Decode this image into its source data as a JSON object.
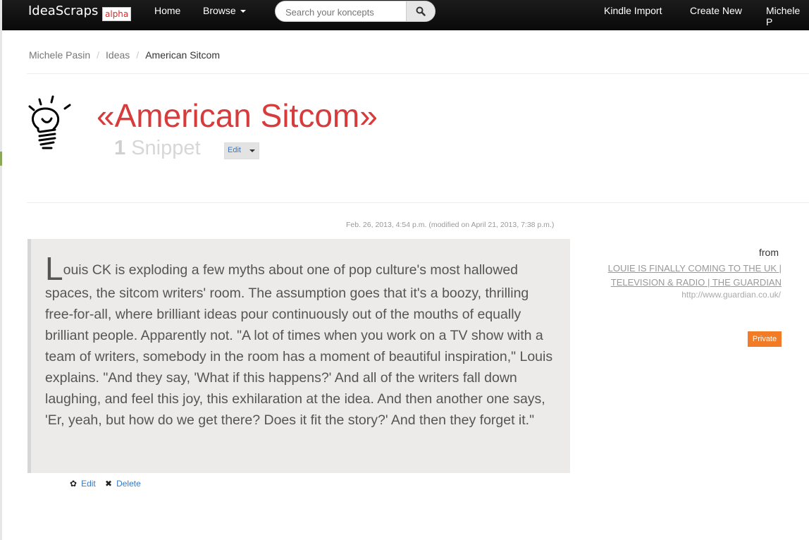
{
  "navbar": {
    "brand": "IdeaScraps",
    "brand_tag": "alpha",
    "links": {
      "home": "Home",
      "browse": "Browse",
      "kindle": "Kindle Import",
      "create": "Create New",
      "user": "Michele P"
    },
    "search": {
      "placeholder": "Search your koncepts",
      "value": ""
    }
  },
  "breadcrumb": [
    "Michele Pasin",
    "Ideas",
    "American Sitcom"
  ],
  "page": {
    "title": "«American Sitcom»",
    "snippet_count": "1",
    "snippet_label": "Snippet",
    "edit_label": "Edit"
  },
  "snippet": {
    "date": "Feb. 26, 2013, 4:54 p.m. (modified on April 21, 2013, 7:38 p.m.)",
    "drop_cap": "L",
    "text": "ouis CK is exploding a few myths about one of pop culture's most hallowed spaces, the sitcom writers' room. The assumption goes that it's a boozy, thrilling free-for-all, where brilliant ideas pour continuously out of the mouths of equally brilliant people. Apparently not. \"A lot of times when you work on a TV show with a team of writers, somebody in the room has a moment of beautiful inspiration,\" Louis explains. \"And they say, 'What if this happens?' And all of the writers fall down laughing, and feel this joy, this exhilaration at the idea. And then another one says, 'Er, yeah, but how do we get there? Does it fit the story?' And then they forget it.\"",
    "actions": {
      "edit": "Edit",
      "delete": "Delete"
    },
    "from_label": "from",
    "source_title": "LOUIE IS FINALLY COMING TO THE UK | TELEVISION & RADIO | THE GUARDIAN",
    "source_url": "http://www.guardian.co.uk/",
    "privacy": "Private"
  },
  "icons": [
    "search-icon",
    "lightbulb-icon",
    "gear-icon",
    "close-icon",
    "chevron-down-icon"
  ],
  "colors": {
    "title": "#d73b3b",
    "private_badge": "#f27b25",
    "link": "#3478c6",
    "navbar": "#111111"
  }
}
